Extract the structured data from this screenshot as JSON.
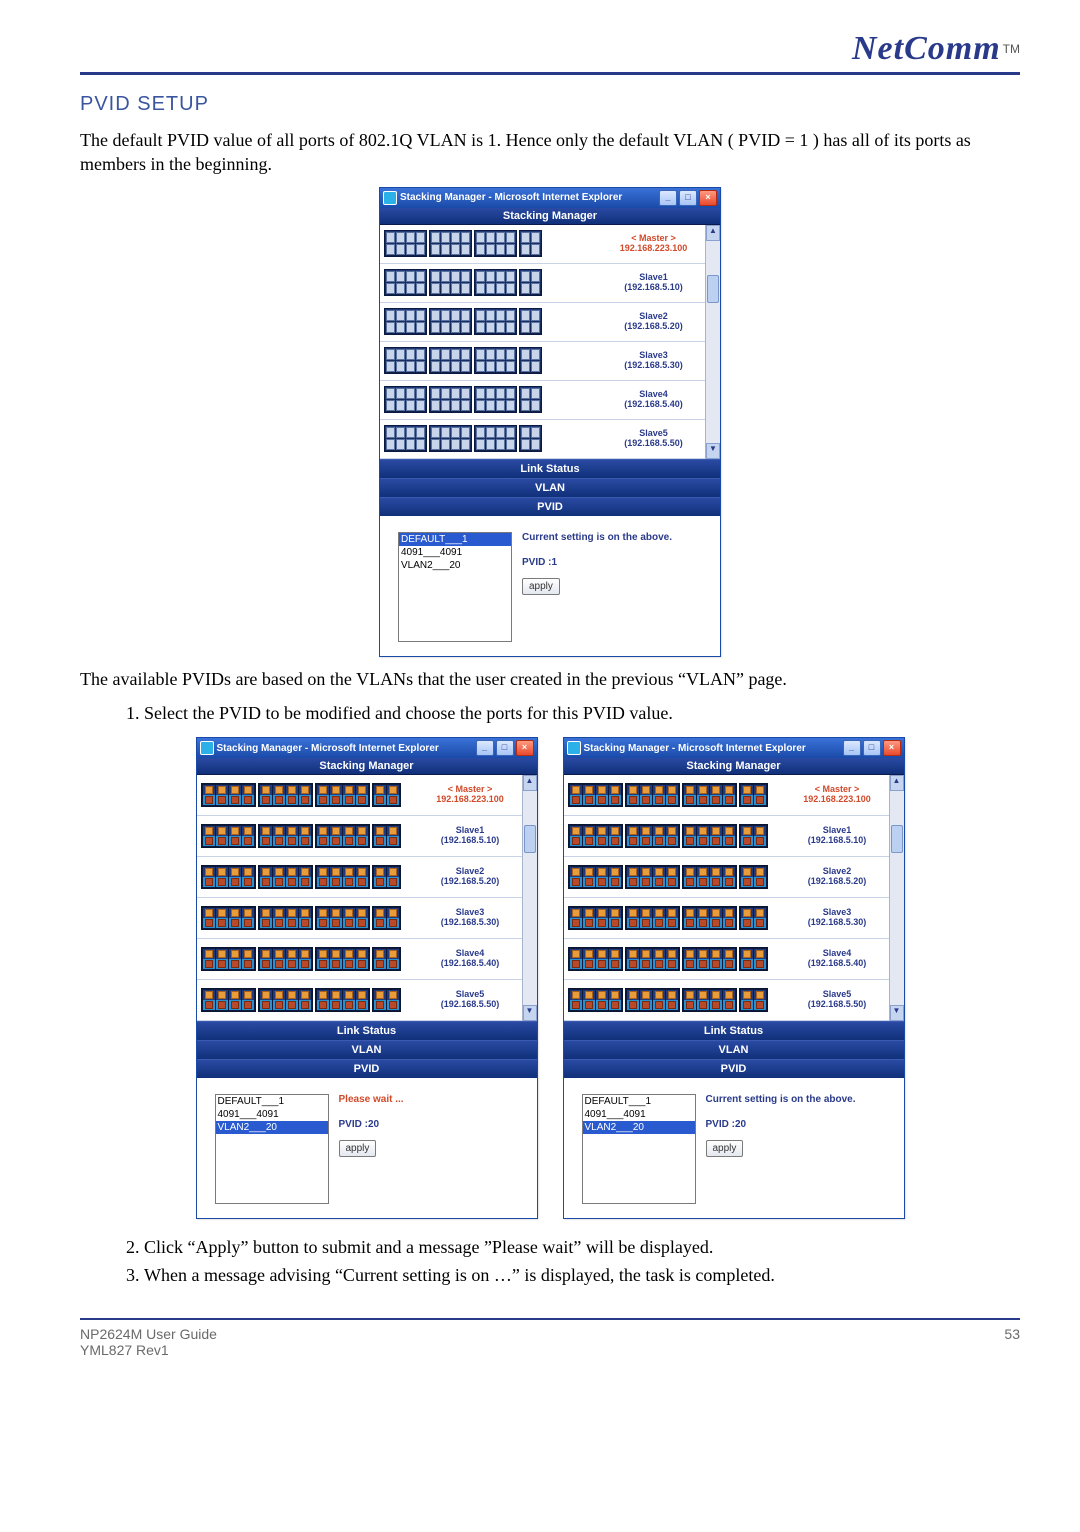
{
  "logo": {
    "text": "NetComm",
    "tm": "TM"
  },
  "section_title": "PVID SETUP",
  "intro": "The default PVID value of all ports of 802.1Q VLAN is 1.  Hence only the default VLAN ( PVID = 1 ) has all of its ports as members in the beginning.",
  "after_fig1": "The available PVIDs are based on the VLANs that the user created in the previous “VLAN” page.",
  "steps": {
    "s1": "Select the PVID to be modified and choose the ports for this PVID value.",
    "s2": "Click “Apply” button to submit and a message ”Please wait” will be displayed.",
    "s3": "When a message  advising “Current setting is on …” is displayed, the task is completed."
  },
  "ie": {
    "title": "Stacking Manager - Microsoft Internet Explorer",
    "minimize": "_",
    "maximize": "□",
    "close": "×"
  },
  "sm": {
    "title": "Stacking Manager",
    "tab_link": "Link Status",
    "tab_vlan": "VLAN",
    "tab_pvid": "PVID"
  },
  "devices": {
    "master": {
      "name": "< Master >",
      "ip": "192.168.223.100"
    },
    "s1": {
      "name": "Slave1",
      "ip": "(192.168.5.10)"
    },
    "s2": {
      "name": "Slave2",
      "ip": "(192.168.5.20)"
    },
    "s3": {
      "name": "Slave3",
      "ip": "(192.168.5.30)"
    },
    "s4": {
      "name": "Slave4",
      "ip": "(192.168.5.40)"
    },
    "s5": {
      "name": "Slave5",
      "ip": "(192.168.5.50)"
    }
  },
  "pvid_list": {
    "i0": "DEFAULT___1",
    "i1": "4091___4091",
    "i2": "VLAN2___20"
  },
  "pvid_panel": {
    "msg_current": "Current setting is on the above.",
    "msg_wait": "Please wait ...",
    "label1": "PVID :1",
    "label20": "PVID :20",
    "apply": "apply"
  },
  "footer": {
    "line1": "NP2624M User Guide",
    "line2": "YML827 Rev1",
    "page": "53"
  }
}
